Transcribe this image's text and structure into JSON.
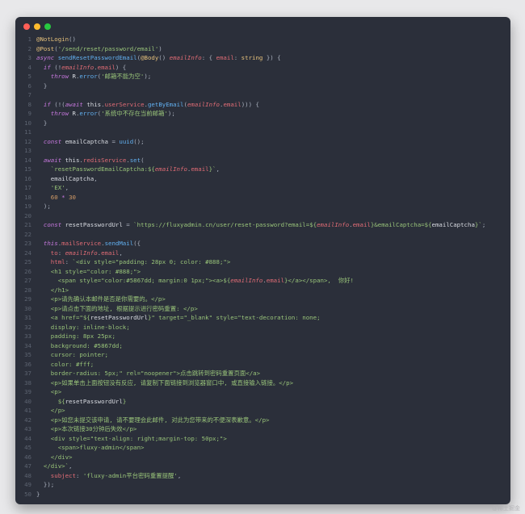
{
  "window": {
    "controls": [
      "close",
      "minimize",
      "maximize"
    ],
    "colors": {
      "background": "#2b2f3a",
      "close": "#ff5f57",
      "minimize": "#febc2e",
      "maximize": "#28c840"
    }
  },
  "code_lines": [
    [
      {
        "t": "@NotLogin",
        "c": "dec"
      },
      {
        "t": "()",
        "c": "punc"
      }
    ],
    [
      {
        "t": "@Post",
        "c": "dec"
      },
      {
        "t": "(",
        "c": "punc"
      },
      {
        "t": "'/send/reset/password/email'",
        "c": "str"
      },
      {
        "t": ")",
        "c": "punc"
      }
    ],
    [
      {
        "t": "async ",
        "c": "kw"
      },
      {
        "t": "sendResetPasswordEmail",
        "c": "fn"
      },
      {
        "t": "(",
        "c": "punc"
      },
      {
        "t": "@Body",
        "c": "dec"
      },
      {
        "t": "() ",
        "c": "punc"
      },
      {
        "t": "emailInfo",
        "c": "var"
      },
      {
        "t": ": { ",
        "c": "punc"
      },
      {
        "t": "email",
        "c": "prop"
      },
      {
        "t": ": ",
        "c": "punc"
      },
      {
        "t": "string",
        "c": "type"
      },
      {
        "t": " }) {",
        "c": "punc"
      }
    ],
    [
      {
        "t": "  if ",
        "c": "kw"
      },
      {
        "t": "(!",
        "c": "punc"
      },
      {
        "t": "emailInfo",
        "c": "var"
      },
      {
        "t": ".",
        "c": "punc"
      },
      {
        "t": "email",
        "c": "prop"
      },
      {
        "t": ") {",
        "c": "punc"
      }
    ],
    [
      {
        "t": "    throw ",
        "c": "kw"
      },
      {
        "t": "R",
        "c": "plain"
      },
      {
        "t": ".",
        "c": "punc"
      },
      {
        "t": "error",
        "c": "fn"
      },
      {
        "t": "(",
        "c": "punc"
      },
      {
        "t": "'邮箱不能为空'",
        "c": "str"
      },
      {
        "t": ");",
        "c": "punc"
      }
    ],
    [
      {
        "t": "  }",
        "c": "punc"
      }
    ],
    [
      {
        "t": "",
        "c": "punc"
      }
    ],
    [
      {
        "t": "  if ",
        "c": "kw"
      },
      {
        "t": "(!(",
        "c": "punc"
      },
      {
        "t": "await ",
        "c": "kw"
      },
      {
        "t": "this",
        "c": "plain"
      },
      {
        "t": ".",
        "c": "punc"
      },
      {
        "t": "userService",
        "c": "prop"
      },
      {
        "t": ".",
        "c": "punc"
      },
      {
        "t": "getByEmail",
        "c": "fn"
      },
      {
        "t": "(",
        "c": "punc"
      },
      {
        "t": "emailInfo",
        "c": "var"
      },
      {
        "t": ".",
        "c": "punc"
      },
      {
        "t": "email",
        "c": "prop"
      },
      {
        "t": "))) {",
        "c": "punc"
      }
    ],
    [
      {
        "t": "    throw ",
        "c": "kw"
      },
      {
        "t": "R",
        "c": "plain"
      },
      {
        "t": ".",
        "c": "punc"
      },
      {
        "t": "error",
        "c": "fn"
      },
      {
        "t": "(",
        "c": "punc"
      },
      {
        "t": "'系统中不存在当前邮箱'",
        "c": "str"
      },
      {
        "t": ");",
        "c": "punc"
      }
    ],
    [
      {
        "t": "  }",
        "c": "punc"
      }
    ],
    [
      {
        "t": "",
        "c": "punc"
      }
    ],
    [
      {
        "t": "  const ",
        "c": "kw"
      },
      {
        "t": "emailCaptcha",
        "c": "plain"
      },
      {
        "t": " = ",
        "c": "punc"
      },
      {
        "t": "uuid",
        "c": "fn"
      },
      {
        "t": "();",
        "c": "punc"
      }
    ],
    [
      {
        "t": "",
        "c": "punc"
      }
    ],
    [
      {
        "t": "  await ",
        "c": "kw"
      },
      {
        "t": "this",
        "c": "plain"
      },
      {
        "t": ".",
        "c": "punc"
      },
      {
        "t": "redisService",
        "c": "prop"
      },
      {
        "t": ".",
        "c": "punc"
      },
      {
        "t": "set",
        "c": "fn"
      },
      {
        "t": "(",
        "c": "punc"
      }
    ],
    [
      {
        "t": "    `resetPasswordEmailCaptcha:${",
        "c": "str"
      },
      {
        "t": "emailInfo",
        "c": "var"
      },
      {
        "t": ".",
        "c": "punc"
      },
      {
        "t": "email",
        "c": "prop"
      },
      {
        "t": "}`",
        "c": "str"
      },
      {
        "t": ",",
        "c": "punc"
      }
    ],
    [
      {
        "t": "    emailCaptcha",
        "c": "plain"
      },
      {
        "t": ",",
        "c": "punc"
      }
    ],
    [
      {
        "t": "    'EX'",
        "c": "str"
      },
      {
        "t": ",",
        "c": "punc"
      }
    ],
    [
      {
        "t": "    60",
        "c": "num"
      },
      {
        "t": " * ",
        "c": "kw"
      },
      {
        "t": "30",
        "c": "num"
      }
    ],
    [
      {
        "t": "  );",
        "c": "punc"
      }
    ],
    [
      {
        "t": "",
        "c": "punc"
      }
    ],
    [
      {
        "t": "  const ",
        "c": "kw"
      },
      {
        "t": "resetPasswordUrl",
        "c": "plain"
      },
      {
        "t": " = ",
        "c": "punc"
      },
      {
        "t": "`https://fluxyadmin.cn/user/reset-password?email=${",
        "c": "str"
      },
      {
        "t": "emailInfo",
        "c": "var"
      },
      {
        "t": ".",
        "c": "punc"
      },
      {
        "t": "email",
        "c": "prop"
      },
      {
        "t": "}&emailCaptcha=${",
        "c": "str"
      },
      {
        "t": "emailCaptcha",
        "c": "plain"
      },
      {
        "t": "}`",
        "c": "str"
      },
      {
        "t": ";",
        "c": "punc"
      }
    ],
    [
      {
        "t": "",
        "c": "punc"
      }
    ],
    [
      {
        "t": "  this",
        "c": "kw"
      },
      {
        "t": ".",
        "c": "punc"
      },
      {
        "t": "mailService",
        "c": "prop"
      },
      {
        "t": ".",
        "c": "punc"
      },
      {
        "t": "sendMail",
        "c": "fn"
      },
      {
        "t": "({",
        "c": "punc"
      }
    ],
    [
      {
        "t": "    to",
        "c": "prop"
      },
      {
        "t": ": ",
        "c": "punc"
      },
      {
        "t": "emailInfo",
        "c": "var"
      },
      {
        "t": ".",
        "c": "punc"
      },
      {
        "t": "email",
        "c": "prop"
      },
      {
        "t": ",",
        "c": "punc"
      }
    ],
    [
      {
        "t": "    html",
        "c": "prop"
      },
      {
        "t": ": ",
        "c": "punc"
      },
      {
        "t": "`<div style=\"padding: 28px 0; color: #888;\">",
        "c": "str"
      }
    ],
    [
      {
        "t": "    <h1 style=\"color: #888;\">",
        "c": "str"
      }
    ],
    [
      {
        "t": "      <span style=\"color:#5867dd; margin:0 1px;\"><a>${",
        "c": "str"
      },
      {
        "t": "emailInfo",
        "c": "var"
      },
      {
        "t": ".",
        "c": "punc"
      },
      {
        "t": "email",
        "c": "prop"
      },
      {
        "t": "}</a></span>,  你好!",
        "c": "str"
      }
    ],
    [
      {
        "t": "    </h1>",
        "c": "str"
      }
    ],
    [
      {
        "t": "    <p>请先确认本邮件是否是你需要的。</p>",
        "c": "str"
      }
    ],
    [
      {
        "t": "    <p>请点击下面的地址, 根据提示进行密码重置: </p>",
        "c": "str"
      }
    ],
    [
      {
        "t": "    <a href=\"${",
        "c": "str"
      },
      {
        "t": "resetPasswordUrl",
        "c": "plain"
      },
      {
        "t": "}\" target=\"_blank\" style=\"text-decoration: none;",
        "c": "str"
      }
    ],
    [
      {
        "t": "    display: inline-block;",
        "c": "str"
      }
    ],
    [
      {
        "t": "    padding: 8px 25px;",
        "c": "str"
      }
    ],
    [
      {
        "t": "    background: #5867dd;",
        "c": "str"
      }
    ],
    [
      {
        "t": "    cursor: pointer;",
        "c": "str"
      }
    ],
    [
      {
        "t": "    color: #fff;",
        "c": "str"
      }
    ],
    [
      {
        "t": "    border-radius: 5px;\" rel=\"noopener\">点击跳转到密码重置页面</a>",
        "c": "str"
      }
    ],
    [
      {
        "t": "    <p>如果单击上面按钮没有反应, 请复制下面链接到浏览器窗口中, 或直接输入链接。</p>",
        "c": "str"
      }
    ],
    [
      {
        "t": "    <p>",
        "c": "str"
      }
    ],
    [
      {
        "t": "      ${",
        "c": "str"
      },
      {
        "t": "resetPasswordUrl",
        "c": "plain"
      },
      {
        "t": "}",
        "c": "str"
      }
    ],
    [
      {
        "t": "    </p>",
        "c": "str"
      }
    ],
    [
      {
        "t": "    <p>如您未提交该申请, 请不要理会此邮件, 对此为您带来的不便深表歉意。</p>",
        "c": "str"
      }
    ],
    [
      {
        "t": "    <p>本次链接30分钟后失效</p>",
        "c": "str"
      }
    ],
    [
      {
        "t": "    <div style=\"text-align: right;margin-top: 50px;\">",
        "c": "str"
      }
    ],
    [
      {
        "t": "      <span>fluxy-admin</span>",
        "c": "str"
      }
    ],
    [
      {
        "t": "    </div>",
        "c": "str"
      }
    ],
    [
      {
        "t": "  </div>`",
        "c": "str"
      },
      {
        "t": ",",
        "c": "punc"
      }
    ],
    [
      {
        "t": "    subject",
        "c": "prop"
      },
      {
        "t": ": ",
        "c": "punc"
      },
      {
        "t": "'fluxy-admin平台密码重置提醒'",
        "c": "str"
      },
      {
        "t": ",",
        "c": "punc"
      }
    ],
    [
      {
        "t": "  });",
        "c": "punc"
      }
    ],
    [
      {
        "t": "}",
        "c": "punc"
      }
    ]
  ],
  "watermark": "@稀土掘金"
}
